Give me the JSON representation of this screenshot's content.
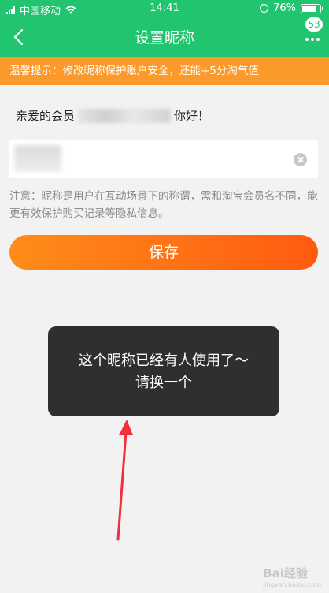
{
  "status_bar": {
    "carrier": "中国移动",
    "time": "14:41",
    "battery": "76%"
  },
  "nav": {
    "title": "设置昵称",
    "message_count": "53"
  },
  "tip": {
    "text": "温馨提示：修改昵称保护账户安全，还能+5分淘气值"
  },
  "greeting": {
    "prefix": "亲爱的会员",
    "suffix": "你好！"
  },
  "nickname_input": {
    "value": ""
  },
  "note": {
    "text": "注意：昵称是用户在互动场景下的称谓，需和淘宝会员名不同，能更有效保护购买记录等隐私信息。"
  },
  "save_button": {
    "label": "保存"
  },
  "toast": {
    "line1": "这个昵称已经有人使用了～",
    "line2": "请换一个"
  },
  "watermark": {
    "text": "Bai经验",
    "sub": "jingyan.baidu.com"
  },
  "colors": {
    "nav_green": "#21c46f",
    "tip_orange": "#fb9a2a",
    "button_gradient_start": "#ff8c1a",
    "button_gradient_end": "#ff5b10",
    "arrow_red": "#f0303a"
  }
}
